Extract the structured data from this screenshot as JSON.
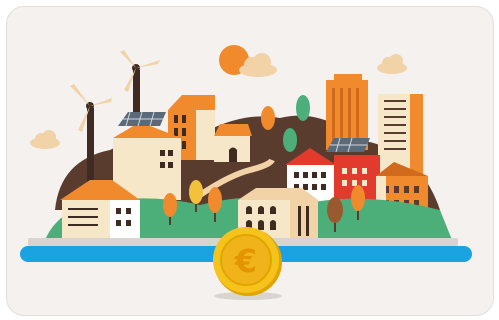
{
  "illustration": {
    "coin_symbol": "€",
    "icons": {
      "sun": "sun-icon",
      "clouds": "cloud-icon",
      "wind_turbines": "wind-turbine-icon",
      "solar_panels": "solar-panel-icon",
      "coin": "euro-coin-icon"
    },
    "colors": {
      "background": "#f4f1ef",
      "hill": "#5a3c2e",
      "grass": "#4caf7a",
      "water": "#1aa3e0",
      "orange": "#f08a2c",
      "cream": "#f6e7c8",
      "coin": "#f6c21c",
      "coin_edge": "#e0a500"
    }
  }
}
